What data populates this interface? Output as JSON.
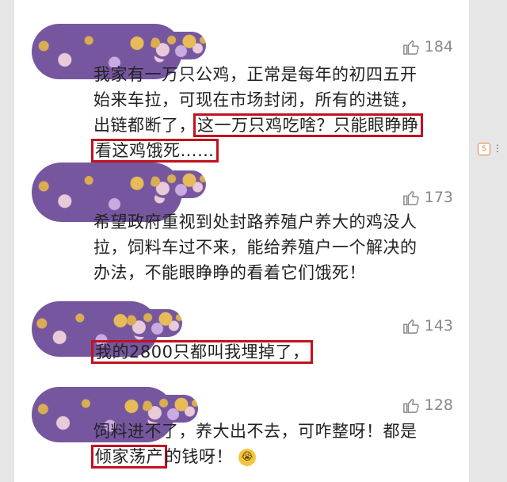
{
  "comments": [
    {
      "likes": "184",
      "line1": "我家有一万只公鸡，正常是每年的初四五开",
      "line2": "始来车拉，可现在市场封闭，所有的进链，",
      "line3_pre": "出链都断了，",
      "line3_hl": "这一万只鸡吃啥？只能眼睁睁",
      "line4_hl": "看这鸡饿死……"
    },
    {
      "likes": "173",
      "line1": "希望政府重视到处封路养殖户养大的鸡没人",
      "line2": "拉，饲料车过不来，能给养殖户一个解决的",
      "line3": "办法，不能眼睁睁的看着它们饿死！"
    },
    {
      "likes": "143",
      "line1_hl": "我的2800只都叫我埋掉了，"
    },
    {
      "likes": "128",
      "line1": "饲料进不了，养大出不去，可咋整呀！都是",
      "line2_hl": "倾家荡产",
      "line2_post": "的钱呀！"
    }
  ],
  "icons": {
    "thumb": "thumbs-up-icon",
    "emoji": "crying-face-emoji",
    "side": "side-badge-icon"
  },
  "side": {
    "badge": "S",
    "dots": "⋮"
  },
  "emoji_glyph": "😭",
  "colors": {
    "highlight_border": "#c1121f",
    "avatar": "#6f4f9a",
    "like_text": "#888888"
  }
}
